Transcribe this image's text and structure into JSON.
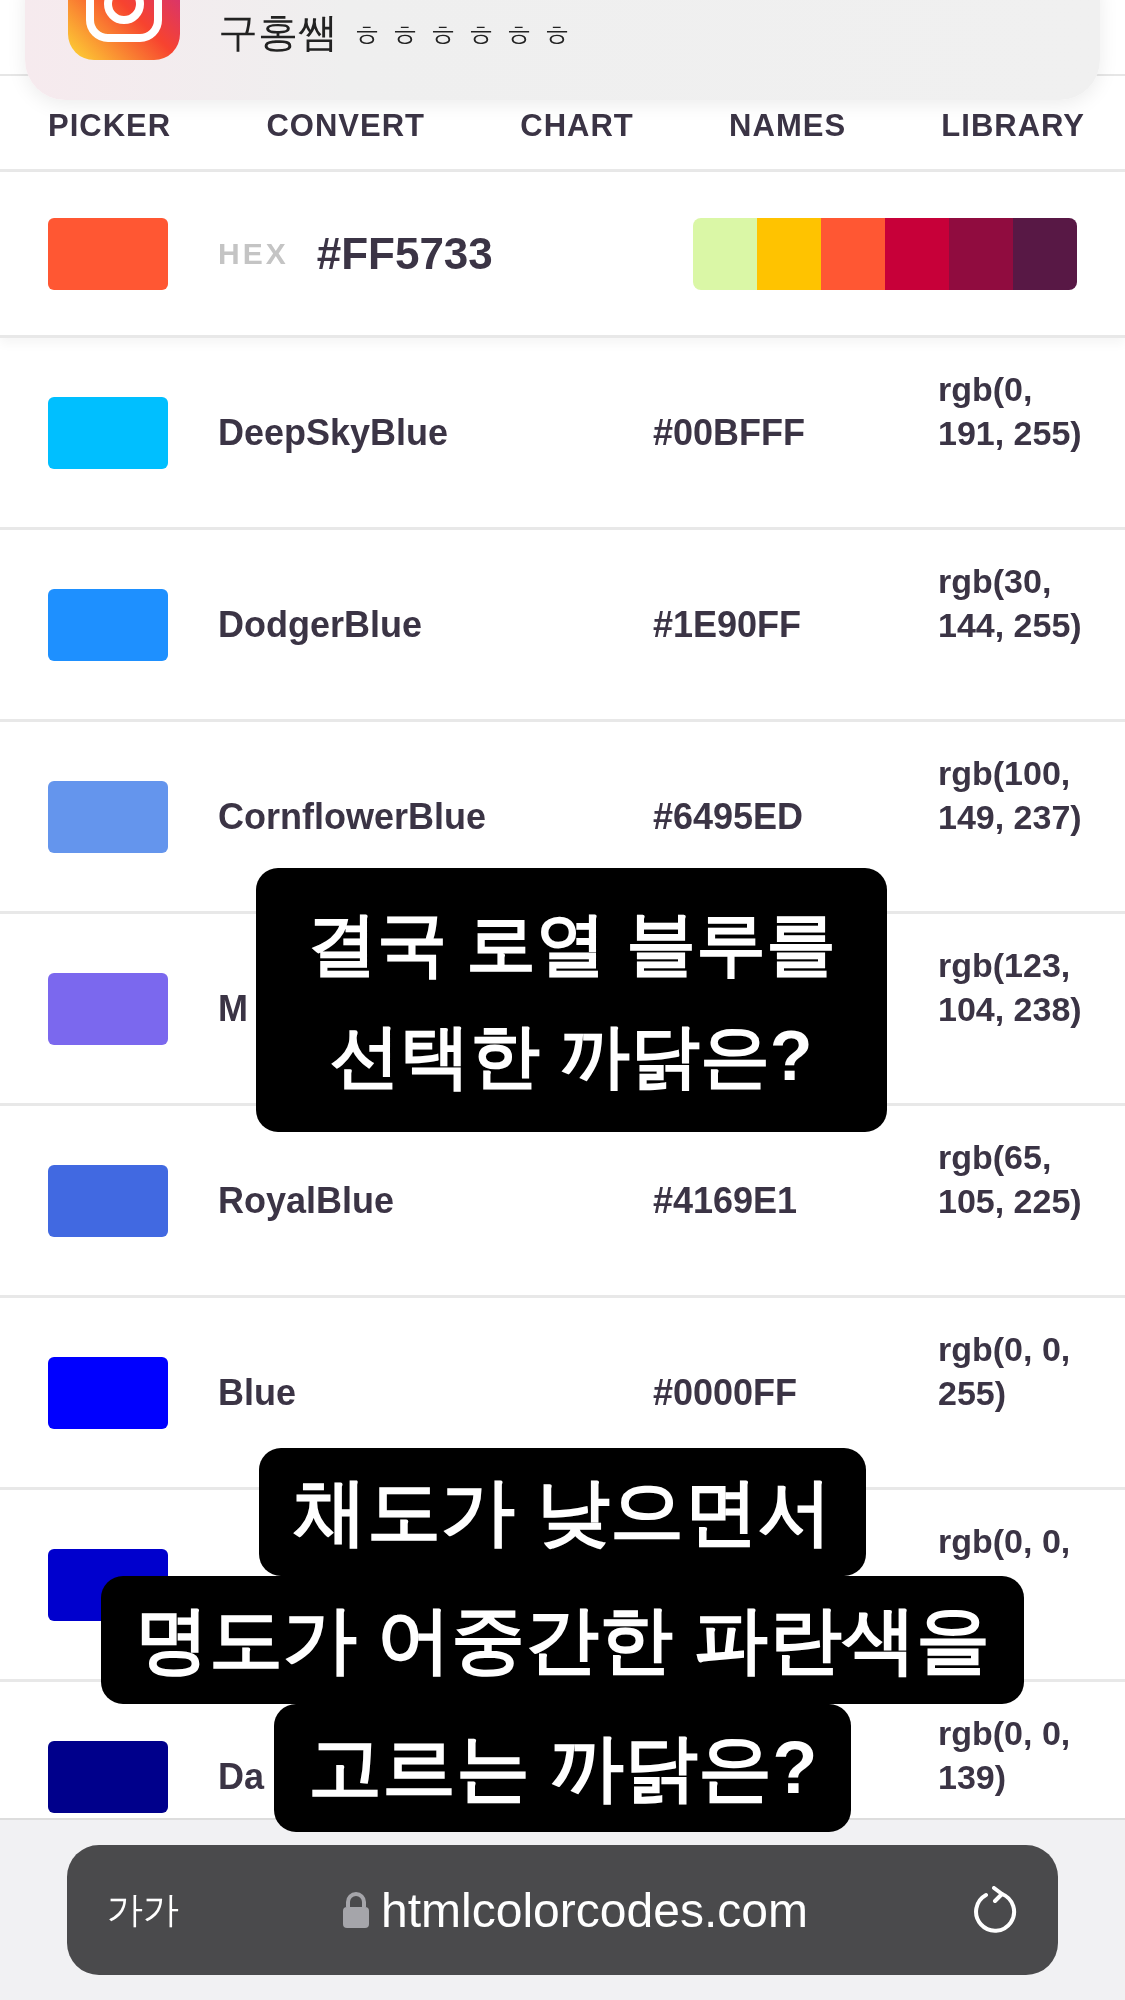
{
  "notification": {
    "sender": "구홍쌤",
    "message": "ㅎㅎㅎㅎㅎㅎ"
  },
  "tabs": [
    {
      "label": "PICKER"
    },
    {
      "label": "CONVERT"
    },
    {
      "label": "CHART"
    },
    {
      "label": "NAMES"
    },
    {
      "label": "LIBRARY"
    }
  ],
  "picker": {
    "color": "#FF5733",
    "label": "HEX",
    "value": "#FF5733",
    "palette": [
      {
        "color": "#DAF7A6"
      },
      {
        "color": "#FFC300"
      },
      {
        "color": "#FF5733"
      },
      {
        "color": "#C70039"
      },
      {
        "color": "#900C3F"
      },
      {
        "color": "#581845"
      }
    ]
  },
  "colors": [
    {
      "color": "#00BFFF",
      "name": "DeepSkyBlue",
      "hex": "#00BFFF",
      "rgb": "rgb(0, 191, 255)"
    },
    {
      "color": "#1E90FF",
      "name": "DodgerBlue",
      "hex": "#1E90FF",
      "rgb": "rgb(30, 144, 255)"
    },
    {
      "color": "#6495ED",
      "name": "CornflowerBlue",
      "hex": "#6495ED",
      "rgb": "rgb(100, 149, 237)"
    },
    {
      "color": "#7B68EE",
      "name": "M",
      "rgb": "rgb(123, 104, 238)"
    },
    {
      "color": "#4169E1",
      "name": "RoyalBlue",
      "hex": "#4169E1",
      "rgb": "rgb(65, 105, 225)"
    },
    {
      "color": "#0000FF",
      "name": "Blue",
      "hex": "#0000FF",
      "rgb": "rgb(0, 0, 255)"
    },
    {
      "color": "#0000CD",
      "rgb": "rgb(0, 0,"
    },
    {
      "color": "#00008B",
      "name": "Da",
      "rgb": "rgb(0, 0, 139)"
    }
  ],
  "captions": [
    {
      "kind": "box",
      "lines": [
        "결국 로열 블루를",
        "선택한 까닭은?"
      ]
    },
    {
      "kind": "strips",
      "lines": [
        "채도가 낮으면서",
        "명도가 어중간한 파란색을",
        "고르는 까닭은?"
      ]
    }
  ],
  "browser_bar": {
    "text_size": "가가",
    "url": "htmlcolorcodes.com"
  }
}
